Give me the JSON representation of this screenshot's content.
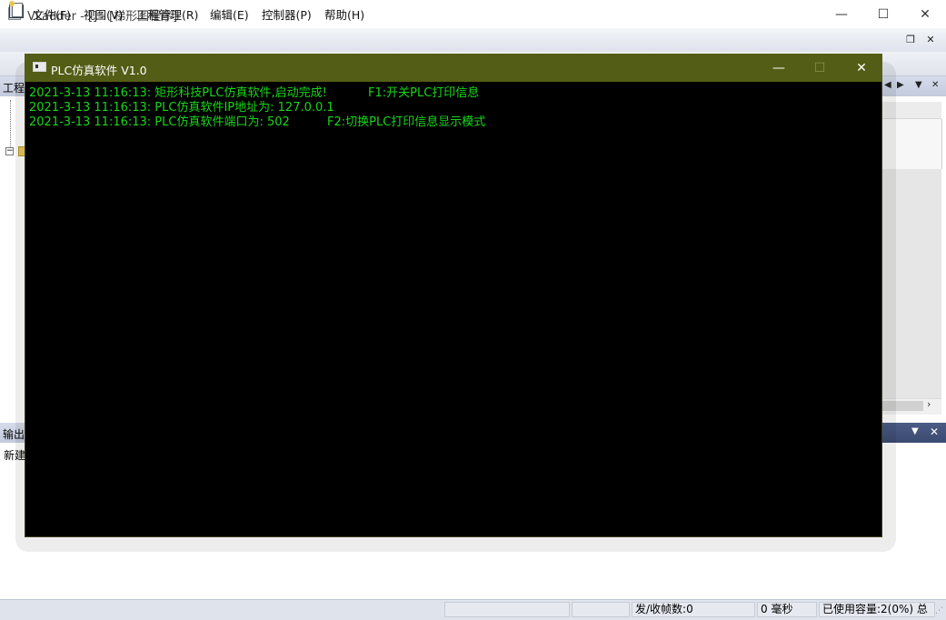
{
  "main_window": {
    "title": "VLadder - [] - [梯形图程序]",
    "buttons": {
      "minimize": "—",
      "maximize": "☐",
      "close": "✕"
    }
  },
  "menu": {
    "items": [
      "文件(F)",
      "视图(V)",
      "工程管理(R)",
      "编辑(E)",
      "控制器(P)",
      "帮助(H)"
    ],
    "mdi": {
      "restore": "❐",
      "close": "✕"
    }
  },
  "project_pane": {
    "title": "工程",
    "toggle": "−"
  },
  "doc_pane": {
    "arrows": [
      "◀",
      "▶",
      "▼",
      "✕"
    ],
    "scroll_right": "›"
  },
  "output_pane": {
    "title": "输出",
    "text": "新建",
    "dropdown": "▼",
    "close": "✕"
  },
  "status_bar": {
    "frames": "发/收帧数:0",
    "latency": "0 毫秒",
    "capacity": "已使用容量:2(0%) 总"
  },
  "console": {
    "title": "PLC仿真软件 V1.0",
    "buttons": {
      "minimize": "—",
      "maximize": "☐",
      "close": "✕"
    },
    "lines": [
      {
        "message": "2021-3-13 11:16:13: 矩形科技PLC仿真软件,启动完成!",
        "hint": "F1:开关PLC打印信息"
      },
      {
        "message": "2021-3-13 11:16:13: PLC仿真软件IP地址为: 127.0.0.1",
        "hint": ""
      },
      {
        "message": "2021-3-13 11:16:13: PLC仿真软件端口为: 502",
        "hint": "F2:切换PLC打印信息显示模式"
      }
    ],
    "text_color": "#19d619",
    "title_bar_color": "#535d16"
  }
}
